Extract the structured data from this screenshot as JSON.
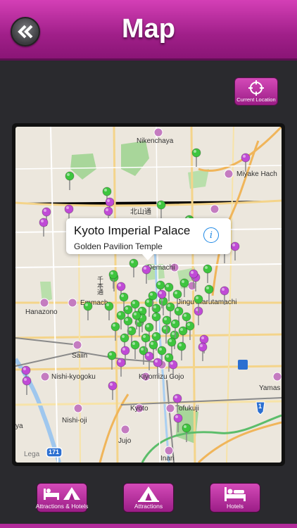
{
  "header": {
    "title": "Map",
    "back_icon": "double-chevron-left-icon"
  },
  "current_location": {
    "label": "Current Location",
    "icon": "crosshair-icon"
  },
  "map": {
    "place_labels": [
      "Nikenchaya",
      "Miyake Hach",
      "北山通",
      "Demachi",
      "Jingu Marutamachi",
      "千本通",
      "Hanazono",
      "Emmach",
      "Saiin",
      "Nishi-kyogoku",
      "Kiyomizu Gojo",
      "Yamas",
      "Kyoto",
      "Tofukuji",
      "Nishi-oji",
      "Jujo",
      "Inari",
      "Lega",
      "171",
      "1",
      "ya"
    ],
    "pin_colors": {
      "green": "#3ec53e",
      "purple": "#c04ad6"
    },
    "callout": {
      "title": "Kyoto Imperial Palace",
      "subtitle": "Golden Pavilion Temple",
      "info_icon": "info-icon"
    }
  },
  "bottom_nav": {
    "attractions_hotels": {
      "label": "Attractions & Hotels",
      "icon": "bed-and-tent-icon"
    },
    "attractions": {
      "label": "Attractions",
      "icon": "tent-icon"
    },
    "hotels": {
      "label": "Hotels",
      "icon": "bed-icon"
    }
  }
}
